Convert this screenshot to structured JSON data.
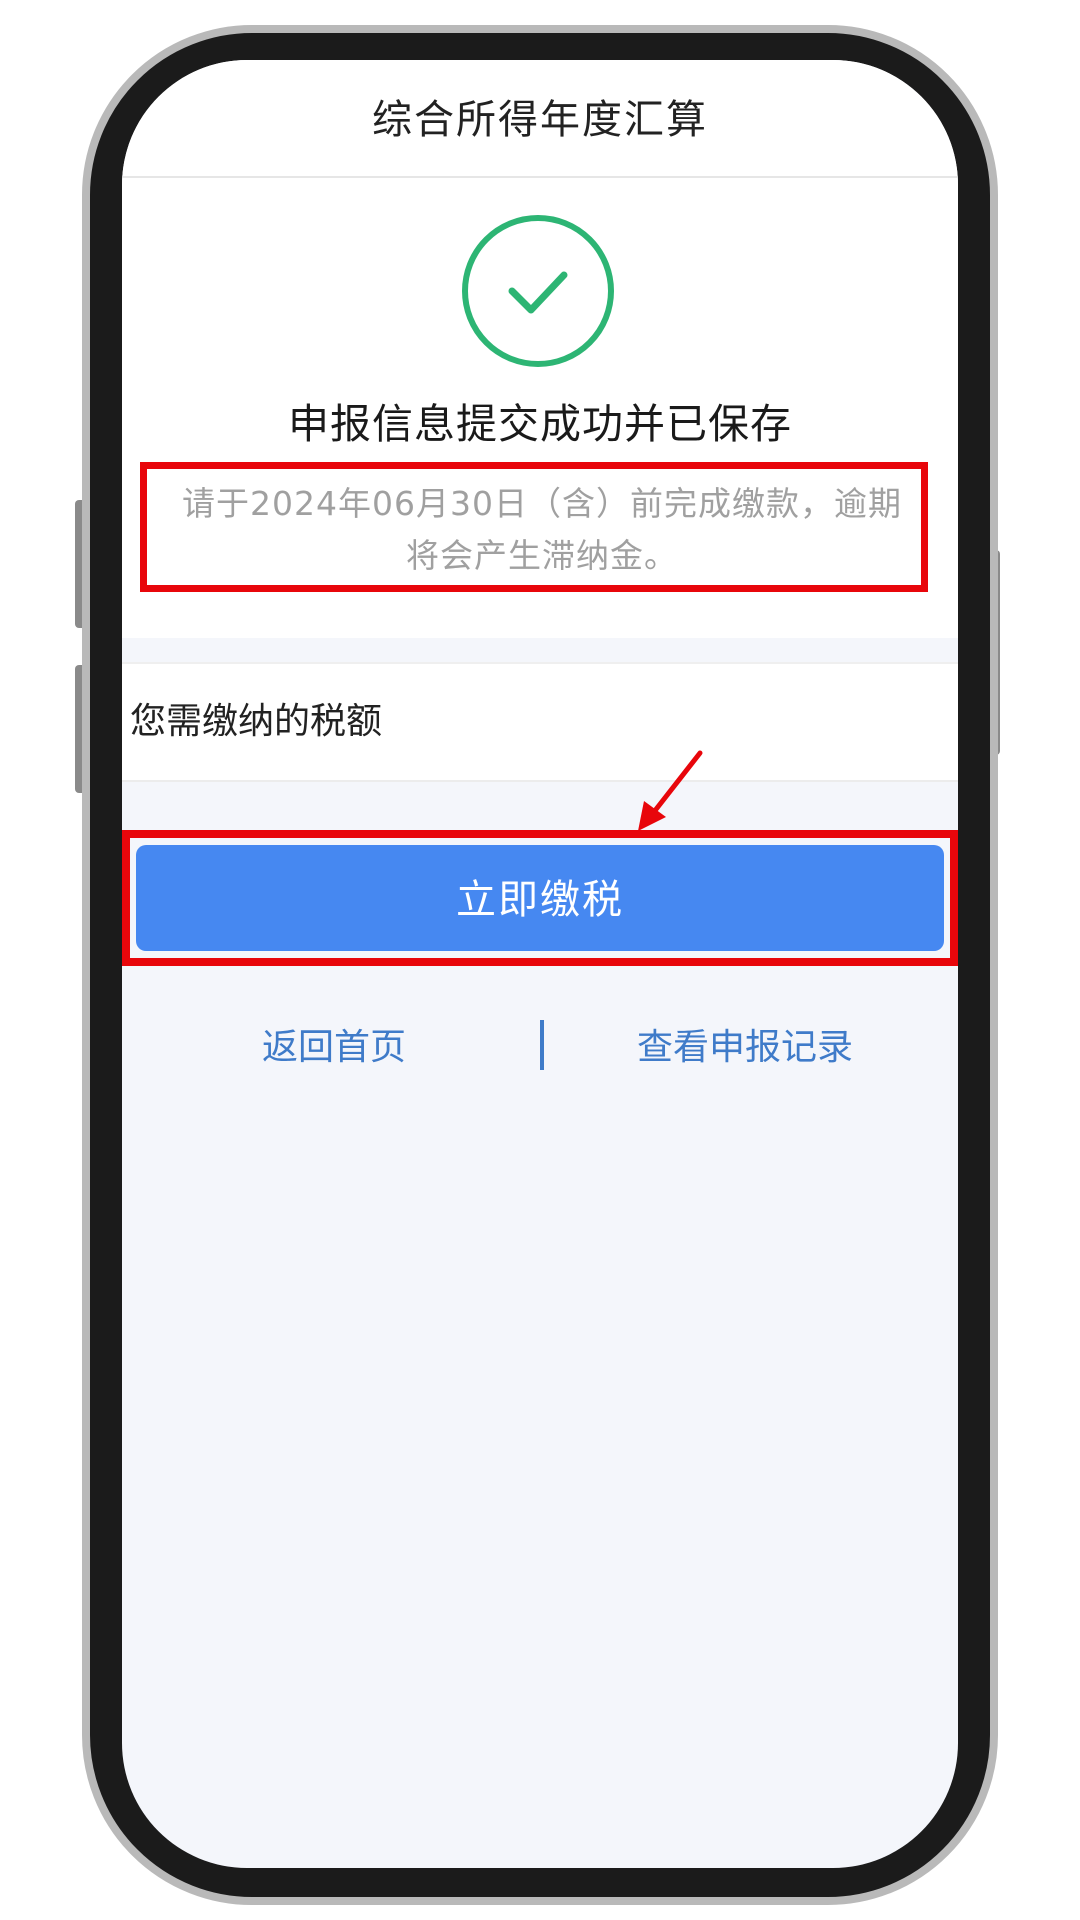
{
  "header": {
    "title": "综合所得年度汇算"
  },
  "result": {
    "icon": "check-circle-icon",
    "title": "申报信息提交成功并已保存",
    "notice_line1": "请于2024年06月30日（含）前完成缴款，逾期",
    "notice_line2": "将会产生滞纳金。"
  },
  "tax": {
    "label": "您需缴纳的税额"
  },
  "actions": {
    "pay_label": "立即缴税",
    "home_label": "返回首页",
    "records_label": "查看申报记录"
  },
  "colors": {
    "accent": "#4688f1",
    "success": "#2db574",
    "highlight": "#e8060b",
    "link": "#3f7bc9"
  }
}
